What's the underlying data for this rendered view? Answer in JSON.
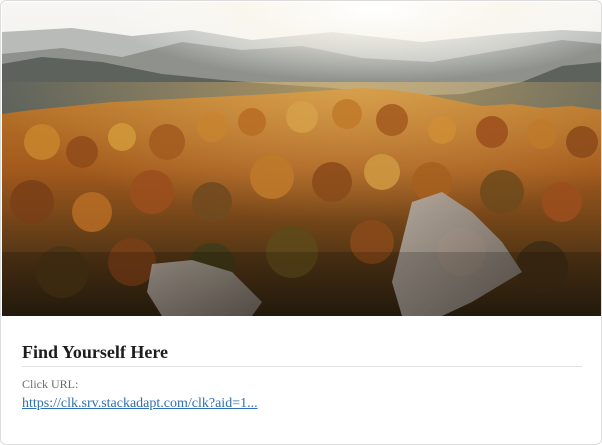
{
  "card": {
    "image": {
      "subject": "aerial view of autumn forest on a mountain with hazy ridges and sunlight"
    },
    "title": "Find Yourself Here",
    "click_url_label": "Click URL:",
    "click_url_text": "https://clk.srv.stackadapt.com/clk?aid=1..."
  },
  "colors": {
    "link": "#2f6fb3",
    "title": "#1d1d1d",
    "label": "#6b6b6b",
    "divider": "#e3e3e3"
  }
}
